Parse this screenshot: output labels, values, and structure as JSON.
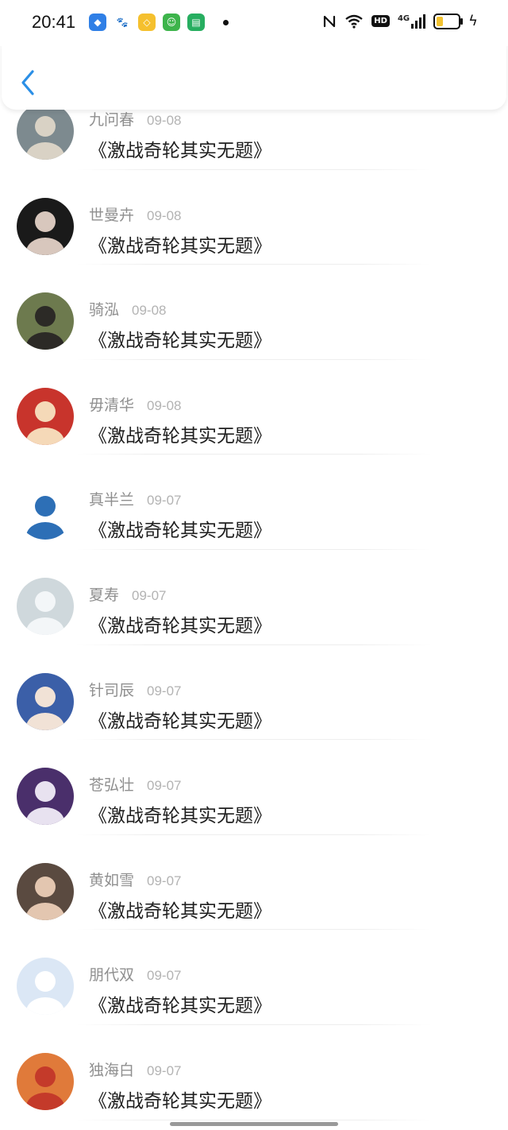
{
  "status_bar": {
    "time": "20:41",
    "network": "4G",
    "hd": "HD",
    "app_icons": [
      {
        "name": "browser-app-icon",
        "color": "#2f7fe6",
        "glyph": "◆"
      },
      {
        "name": "baidu-app-icon",
        "color": "#ffffff",
        "glyph": "🐾"
      },
      {
        "name": "diamond-app-icon",
        "color": "#f5c02e",
        "glyph": "◇"
      },
      {
        "name": "shop-app-icon",
        "color": "#3db44b",
        "glyph": "☺"
      },
      {
        "name": "message-app-icon",
        "color": "#27ae60",
        "glyph": "▤"
      }
    ]
  },
  "header": {
    "back_icon": "chevron-left-icon",
    "accent": "#2b8fe6"
  },
  "comments": [
    {
      "user": "九问春",
      "date": "09-08",
      "text": "《激战奇轮其实无题》",
      "avatar_bg": "#7d8a8f",
      "avatar_fg": "#d9d2c5"
    },
    {
      "user": "世曼卉",
      "date": "09-08",
      "text": "《激战奇轮其实无题》",
      "avatar_bg": "#1a1a1a",
      "avatar_fg": "#d8c7bd"
    },
    {
      "user": "骑泓",
      "date": "09-08",
      "text": "《激战奇轮其实无题》",
      "avatar_bg": "#6d7a4e",
      "avatar_fg": "#2c2a26"
    },
    {
      "user": "毋清华",
      "date": "09-08",
      "text": "《激战奇轮其实无题》",
      "avatar_bg": "#c8342c",
      "avatar_fg": "#f5d9b8"
    },
    {
      "user": "真半兰",
      "date": "09-07",
      "text": "《激战奇轮其实无题》",
      "avatar_bg": "#ffffff",
      "avatar_fg": "#2d6fb6"
    },
    {
      "user": "夏寿",
      "date": "09-07",
      "text": "《激战奇轮其实无题》",
      "avatar_bg": "#cfd8dc",
      "avatar_fg": "#f3f6f8"
    },
    {
      "user": "针司辰",
      "date": "09-07",
      "text": "《激战奇轮其实无题》",
      "avatar_bg": "#3b5fa8",
      "avatar_fg": "#f1e2d6"
    },
    {
      "user": "苍弘壮",
      "date": "09-07",
      "text": "《激战奇轮其实无题》",
      "avatar_bg": "#4a2f6b",
      "avatar_fg": "#e8e2f0"
    },
    {
      "user": "黄如雪",
      "date": "09-07",
      "text": "《激战奇轮其实无题》",
      "avatar_bg": "#5a4a40",
      "avatar_fg": "#e3c6b0"
    },
    {
      "user": "朋代双",
      "date": "09-07",
      "text": "《激战奇轮其实无题》",
      "avatar_bg": "#dbe7f5",
      "avatar_fg": "#ffffff"
    },
    {
      "user": "独海白",
      "date": "09-07",
      "text": "《激战奇轮其实无题》",
      "avatar_bg": "#e07a3a",
      "avatar_fg": "#c43a2a"
    }
  ]
}
